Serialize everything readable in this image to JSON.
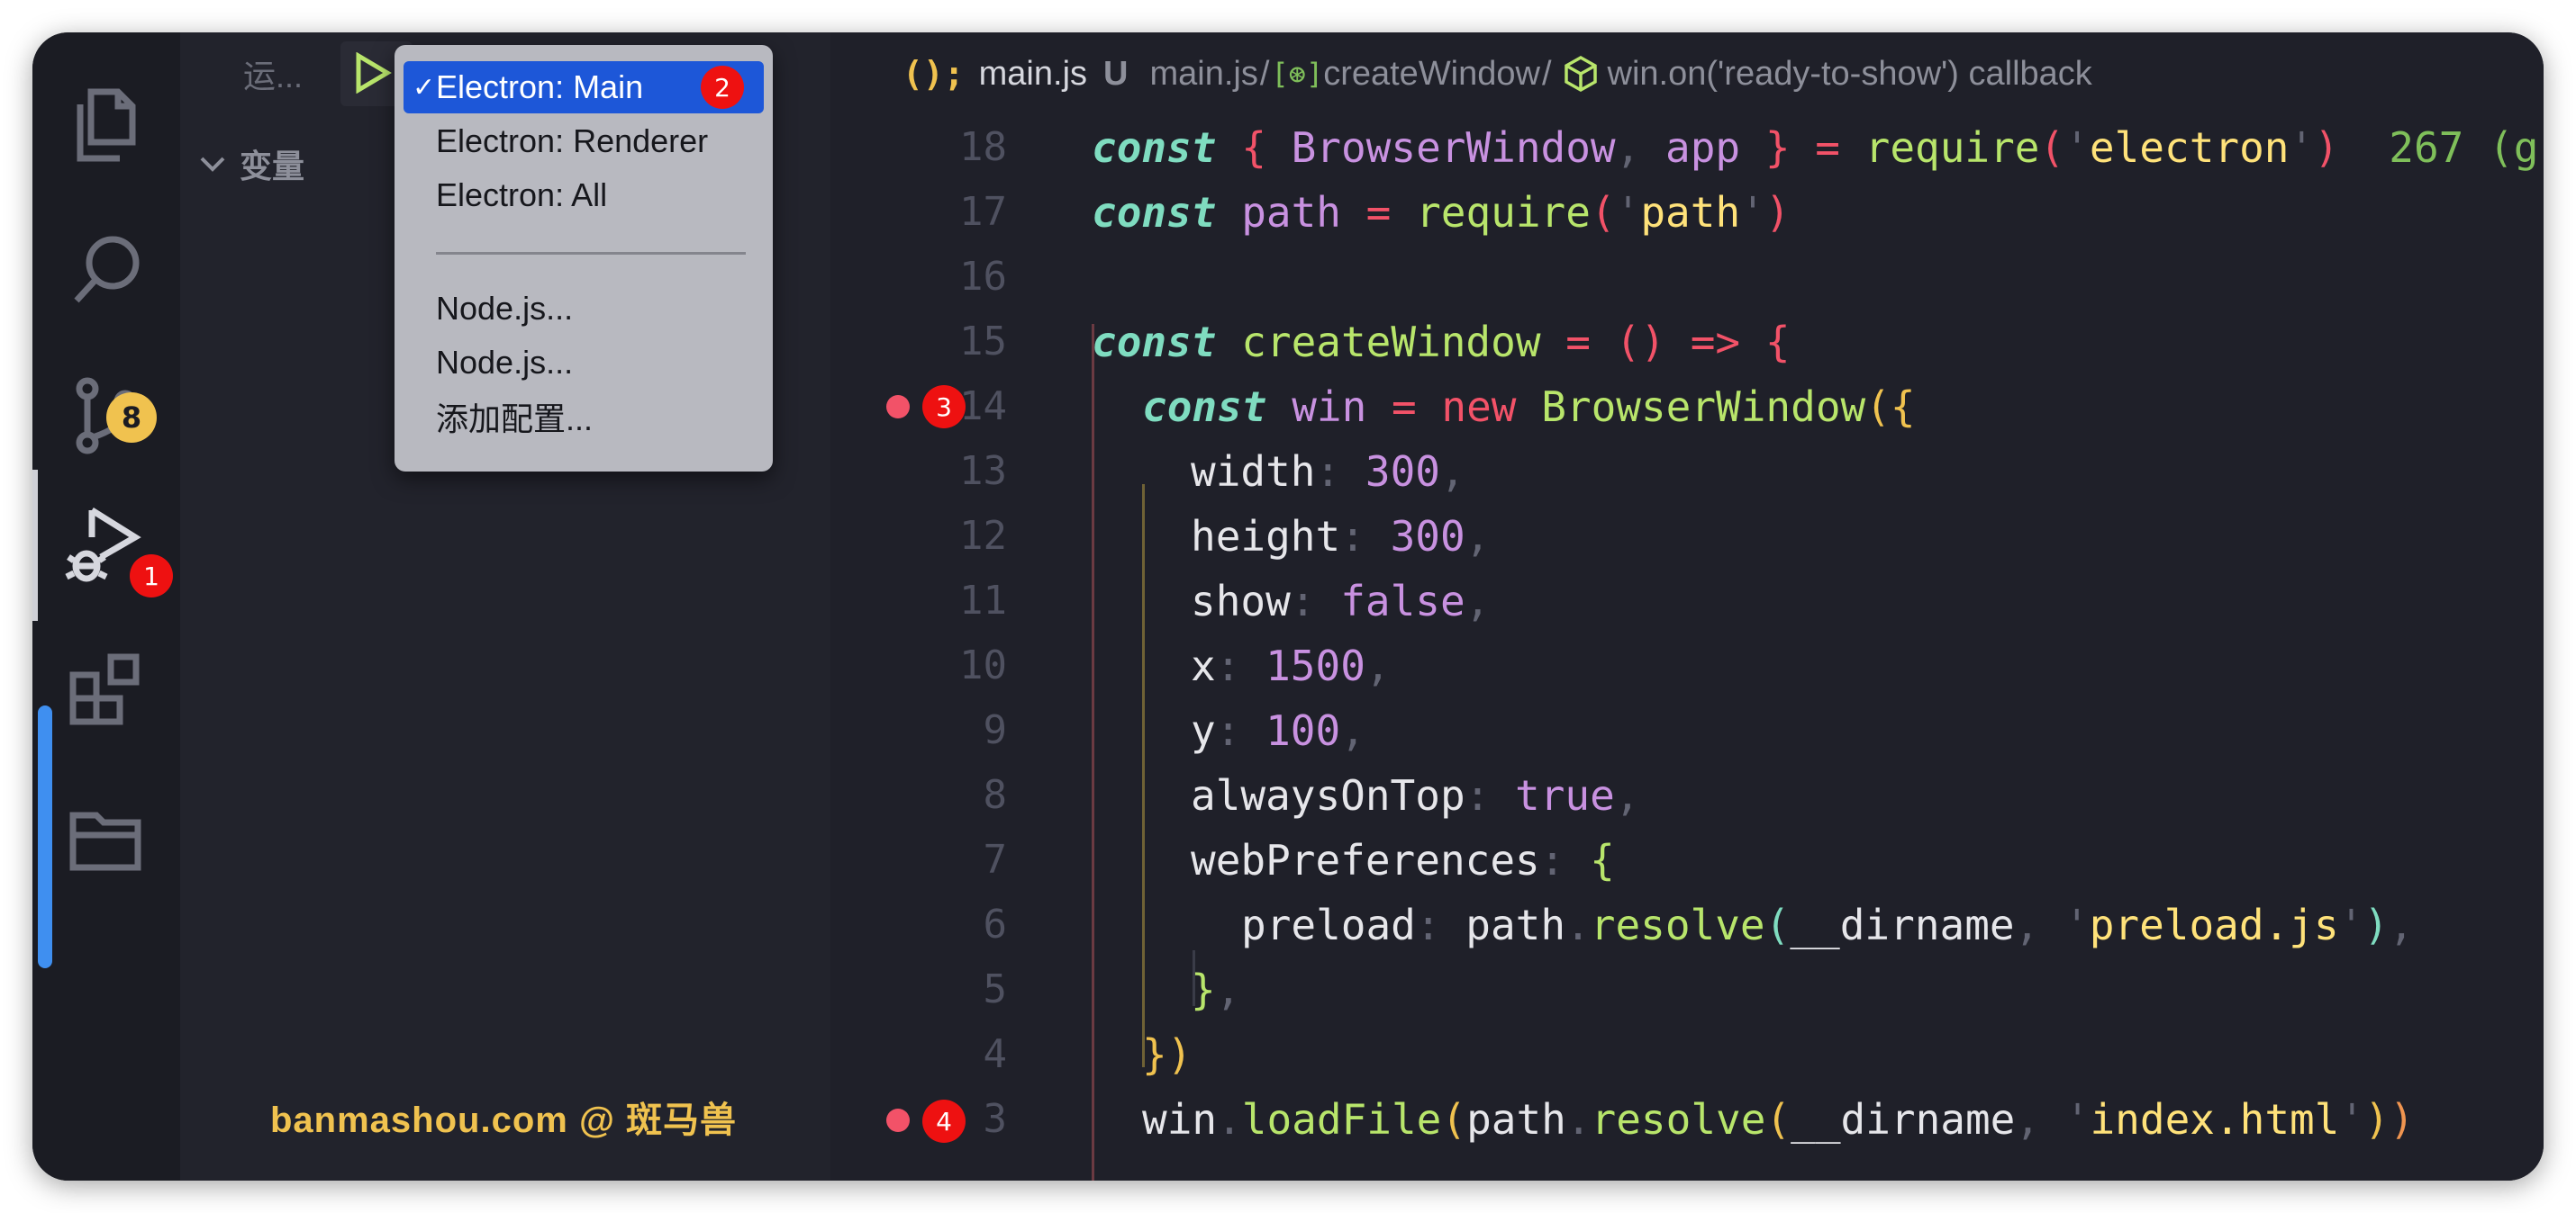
{
  "activity_bar": {
    "items": [
      {
        "name": "explorer",
        "icon": "files-icon"
      },
      {
        "name": "search",
        "icon": "search-icon"
      },
      {
        "name": "source-control",
        "icon": "source-control-icon",
        "badge": "8"
      },
      {
        "name": "run-debug",
        "icon": "debug-icon",
        "active": true,
        "annotation": "1"
      },
      {
        "name": "extensions",
        "icon": "extensions-icon"
      },
      {
        "name": "folders",
        "icon": "folder-icon"
      }
    ]
  },
  "sidebar": {
    "title": "运...",
    "variables_header": "变量",
    "watermark": "banmashou.com @ 斑马兽"
  },
  "dropdown": {
    "annotation": "2",
    "items": [
      {
        "label": "Electron: Main",
        "selected": true,
        "check": "✓"
      },
      {
        "label": "Electron: Renderer"
      },
      {
        "label": "Electron: All"
      },
      {
        "label": "Node.js..."
      },
      {
        "label": "Node.js..."
      },
      {
        "label": "添加配置..."
      }
    ]
  },
  "breadcrumbs": {
    "fn_icon": "();",
    "file": "main.js",
    "status": "U",
    "path_1": "main.js",
    "sep": "/",
    "symbol_icon": "[⊛]",
    "path_2": "createWindow",
    "path_3": "win.on('ready-to-show') callback"
  },
  "editor": {
    "line_numbers": [
      "18",
      "17",
      "16",
      "15",
      "14",
      "13",
      "12",
      "11",
      "10",
      "9",
      "8",
      "7",
      "6",
      "5",
      "4",
      "3"
    ],
    "breakpoint_annotations": {
      "line14": "3",
      "line3": "4"
    },
    "blame_text": "267 (g",
    "colors": {
      "keyword": "#7fdcc0",
      "variable": "#c891e0",
      "function": "#b8e56b",
      "string": "#ffe27a",
      "operator": "#f25268",
      "breakpoint": "#f25268"
    }
  }
}
